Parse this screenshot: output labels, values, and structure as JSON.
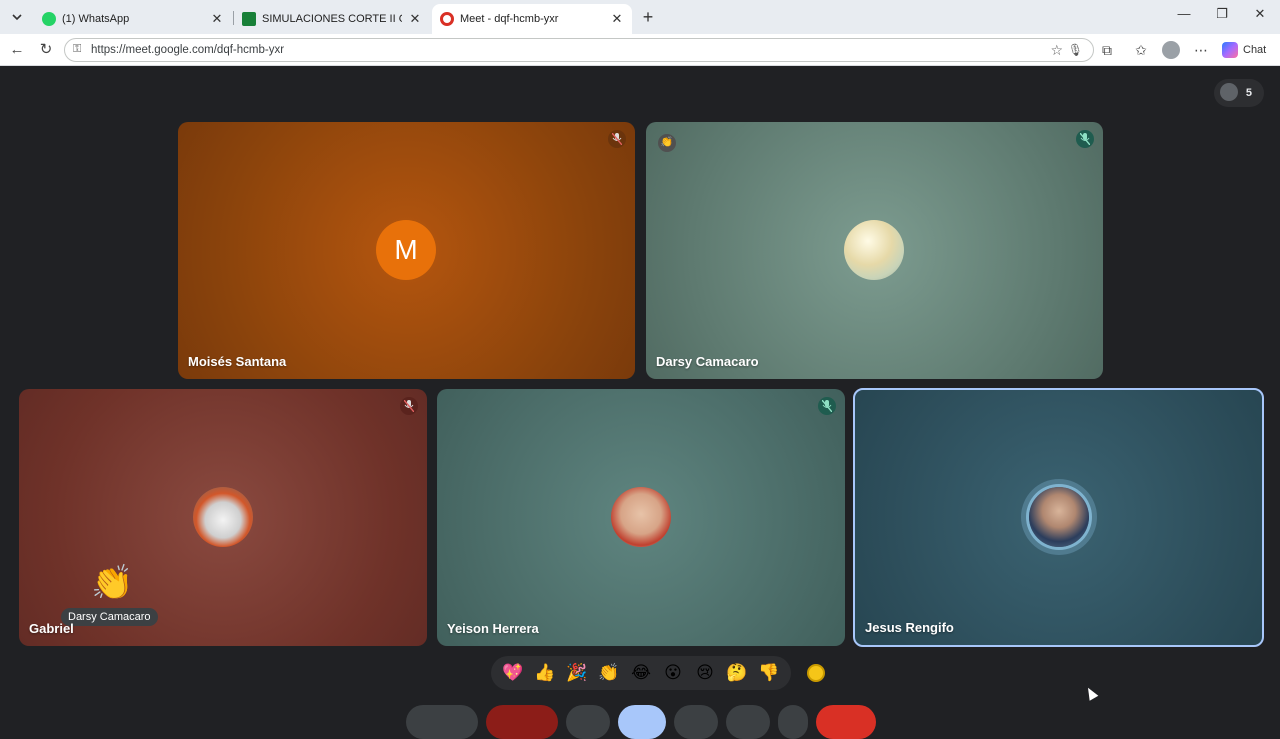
{
  "browser": {
    "tabs": [
      {
        "title": "(1) WhatsApp",
        "favicon_color": "#25d366"
      },
      {
        "title": "SIMULACIONES CORTE II OCT-FEB",
        "favicon_color": "#188038"
      },
      {
        "title": "Meet - dqf-hcmb-yxr",
        "favicon_color": "#d93025"
      }
    ],
    "url": "https://meet.google.com/dqf-hcmb-yxr",
    "chat_label": "Chat"
  },
  "meet": {
    "participant_count": "5",
    "participants": [
      {
        "name": "Moisés Santana",
        "initial": "M",
        "bg": "#a24f0d"
      },
      {
        "name": "Darsy Camacaro",
        "bg": "#6c8b80"
      },
      {
        "name": "Gabriel",
        "bg": "#7b3d34"
      },
      {
        "name": "Yeison Herrera",
        "bg": "#557873"
      },
      {
        "name": "Jesus Rengifo",
        "bg": "#335866"
      }
    ],
    "reaction_sender": "Darsy Camacaro",
    "reactions": [
      "💖",
      "👍",
      "🎉",
      "👏",
      "😂",
      "😮",
      "😢",
      "🤔",
      "👎"
    ]
  }
}
